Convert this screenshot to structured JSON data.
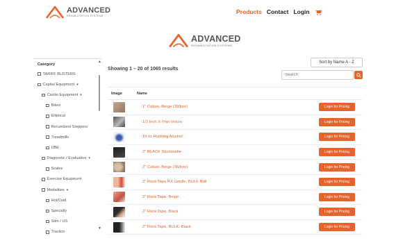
{
  "brand": {
    "name": "ADVANCED",
    "tagline": "REHABILITATION SYSTEMS",
    "accent_color": "#e8622c"
  },
  "nav": {
    "products": "Products",
    "contact": "Contact",
    "login": "Login",
    "cart_icon": "cart-icon"
  },
  "sidebar": {
    "heading": "Category",
    "items": [
      {
        "label": "TARIFF BUSTERS"
      },
      {
        "label": "Capital Equipment",
        "caret": "▾"
      },
      {
        "label": "Cardio Equipment",
        "caret": "▾"
      },
      {
        "label": "Bikes"
      },
      {
        "label": "Elliptical"
      },
      {
        "label": "Recumbent Steppers"
      },
      {
        "label": "Treadmills"
      },
      {
        "label": "UBE"
      },
      {
        "label": "Diagnostic / Evaluation",
        "caret": "▾"
      },
      {
        "label": "Scales"
      },
      {
        "label": "Exercise Equipment"
      },
      {
        "label": "Modalities",
        "caret": "▾"
      },
      {
        "label": "Hot/Cold"
      },
      {
        "label": "Specialty"
      },
      {
        "label": "Stim / US"
      },
      {
        "label": "Traction"
      }
    ]
  },
  "main": {
    "showing": "Showing 1 – 20 of 1065 results",
    "sort_selected": "Sort by Name A - Z",
    "search_placeholder": "Search",
    "search_icon": "search-icon",
    "columns": {
      "image": "Image",
      "name": "Name"
    },
    "products": [
      {
        "name": "1\" Coban, Beige (30/box)",
        "action": "Login for Pricing"
      },
      {
        "name": "1/2 Inch X-Thin Velcro",
        "action": "Login for Pricing"
      },
      {
        "name": "16 oz Rubbing Alcohol",
        "action": "Login for Pricing"
      },
      {
        "name": "2\" BLACK Stockinette",
        "action": "Login for Pricing"
      },
      {
        "name": "2\" Coban, Beige (36/box)",
        "action": "Login for Pricing"
      },
      {
        "name": "2\" Rock Tape RX Gentle, BULK Roll",
        "action": "Login for Pricing"
      },
      {
        "name": "2\" Rock Tape, Beige",
        "action": "Login for Pricing"
      },
      {
        "name": "2\" Rock Tape, Black",
        "action": "Login for Pricing"
      },
      {
        "name": "2\" Rock Tape, BULK, Black",
        "action": "Login for Pricing"
      }
    ]
  }
}
